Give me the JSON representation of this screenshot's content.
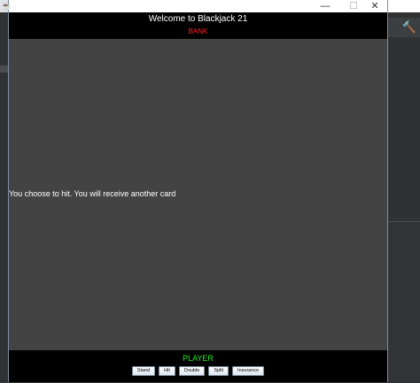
{
  "window": {
    "title": "Welcome to Blackjack 21",
    "controls": {
      "minimize": "—",
      "maximize": "☐",
      "close": "✕"
    }
  },
  "header": {
    "title": "Welcome to Blackjack 21",
    "bank_label": "BANK"
  },
  "table": {
    "message": "You choose to hit. You will receive another card"
  },
  "footer": {
    "player_label": "PLAYER",
    "buttons": [
      "Stand",
      "Hit",
      "Double",
      "Split",
      "Insurance"
    ]
  },
  "colors": {
    "header_bg": "#000000",
    "table_bg": "#434343",
    "bank_label": "#ff2020",
    "player_label": "#22ee22",
    "text": "#ffffff"
  },
  "icons": {
    "app_icon": "java-app-icon",
    "ide_tool": "hammer-icon"
  }
}
